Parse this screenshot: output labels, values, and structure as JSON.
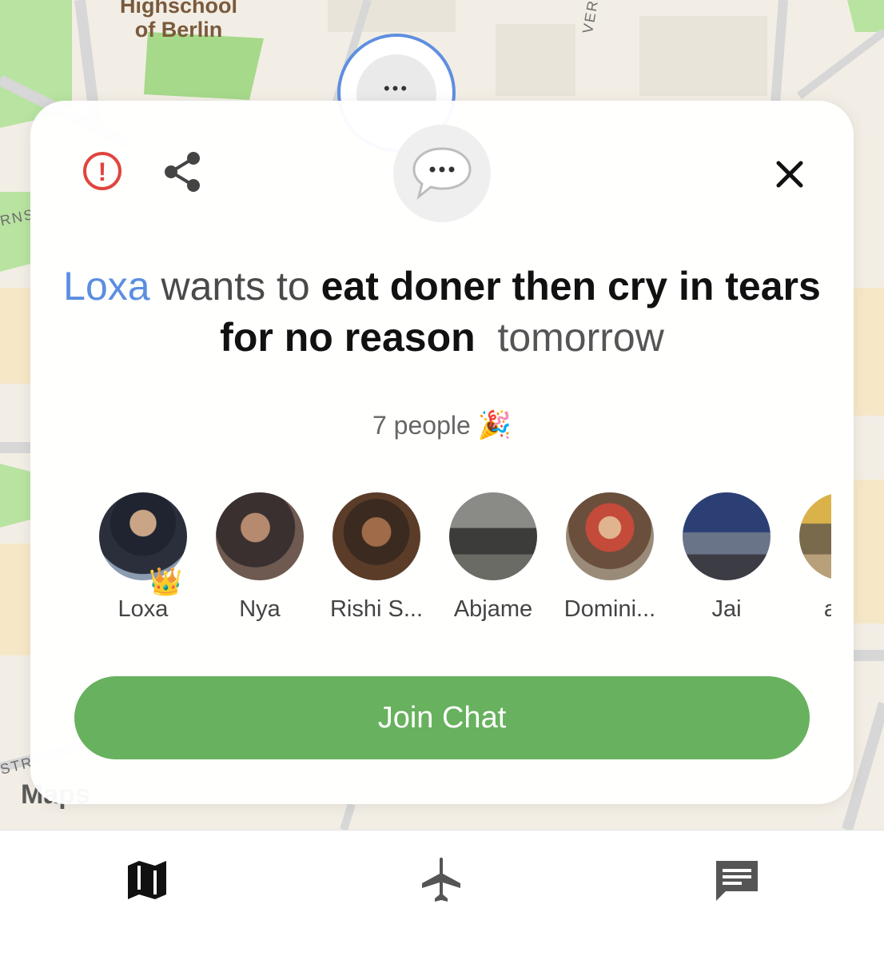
{
  "map": {
    "poi_label": "Highschool\nof Berlin",
    "street_right": "VER STRAßE",
    "street_left": "RNS",
    "street_bottom": "STR",
    "attribution": "Maps"
  },
  "card": {
    "icons": {
      "report": "report-icon",
      "share": "share-icon",
      "chat": "speech-bubble-icon",
      "close": "close-icon"
    },
    "headline": {
      "who": "Loxa",
      "verb": " wants to ",
      "what": "eat doner then cry in tears for no reason",
      "when": "tomorrow"
    },
    "people_count": "7 people",
    "people_emoji": "🎉",
    "members": [
      {
        "name": "Loxa",
        "host": true
      },
      {
        "name": "Nya",
        "host": false
      },
      {
        "name": "Rishi S...",
        "host": false
      },
      {
        "name": "Abjame",
        "host": false
      },
      {
        "name": "Domini...",
        "host": false
      },
      {
        "name": "Jai",
        "host": false
      },
      {
        "name": "arib",
        "host": false
      }
    ],
    "crown_emoji": "👑",
    "join_label": "Join Chat"
  },
  "tabbar": {
    "tabs": [
      {
        "icon": "map-icon",
        "active": true
      },
      {
        "icon": "airplane-icon",
        "active": false
      },
      {
        "icon": "chat-icon",
        "active": false
      }
    ]
  }
}
